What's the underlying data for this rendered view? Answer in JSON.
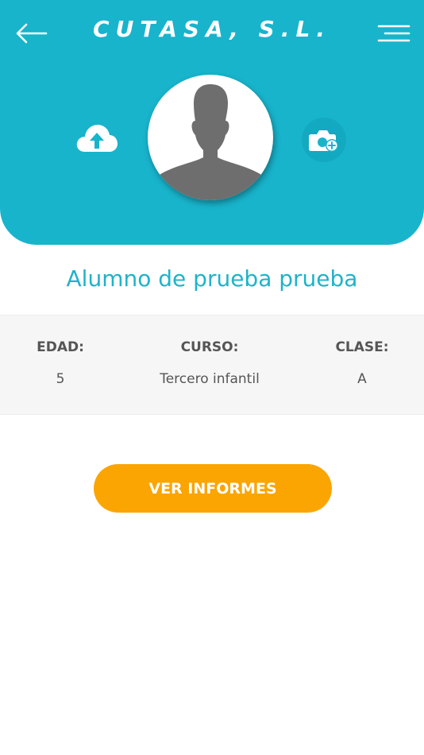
{
  "colors": {
    "header_bg": "#18b4cc",
    "accent": "#1fb3c9",
    "button_bg": "#fba502",
    "panel_bg": "#f6f6f6"
  },
  "header": {
    "title": "CUTASA, S.L.",
    "back_icon": "arrow-left-icon",
    "menu_icon": "hamburger-menu-icon",
    "upload_icon": "cloud-upload-icon",
    "camera_icon": "camera-add-icon",
    "avatar_icon": "person-silhouette-icon"
  },
  "student": {
    "name": "Alumno de prueba prueba"
  },
  "info": {
    "edad_label": "EDAD:",
    "edad_value": "5",
    "curso_label": "CURSO:",
    "curso_value": "Tercero infantil",
    "clase_label": "CLASE:",
    "clase_value": "A"
  },
  "actions": {
    "report_label": "VER INFORMES"
  }
}
